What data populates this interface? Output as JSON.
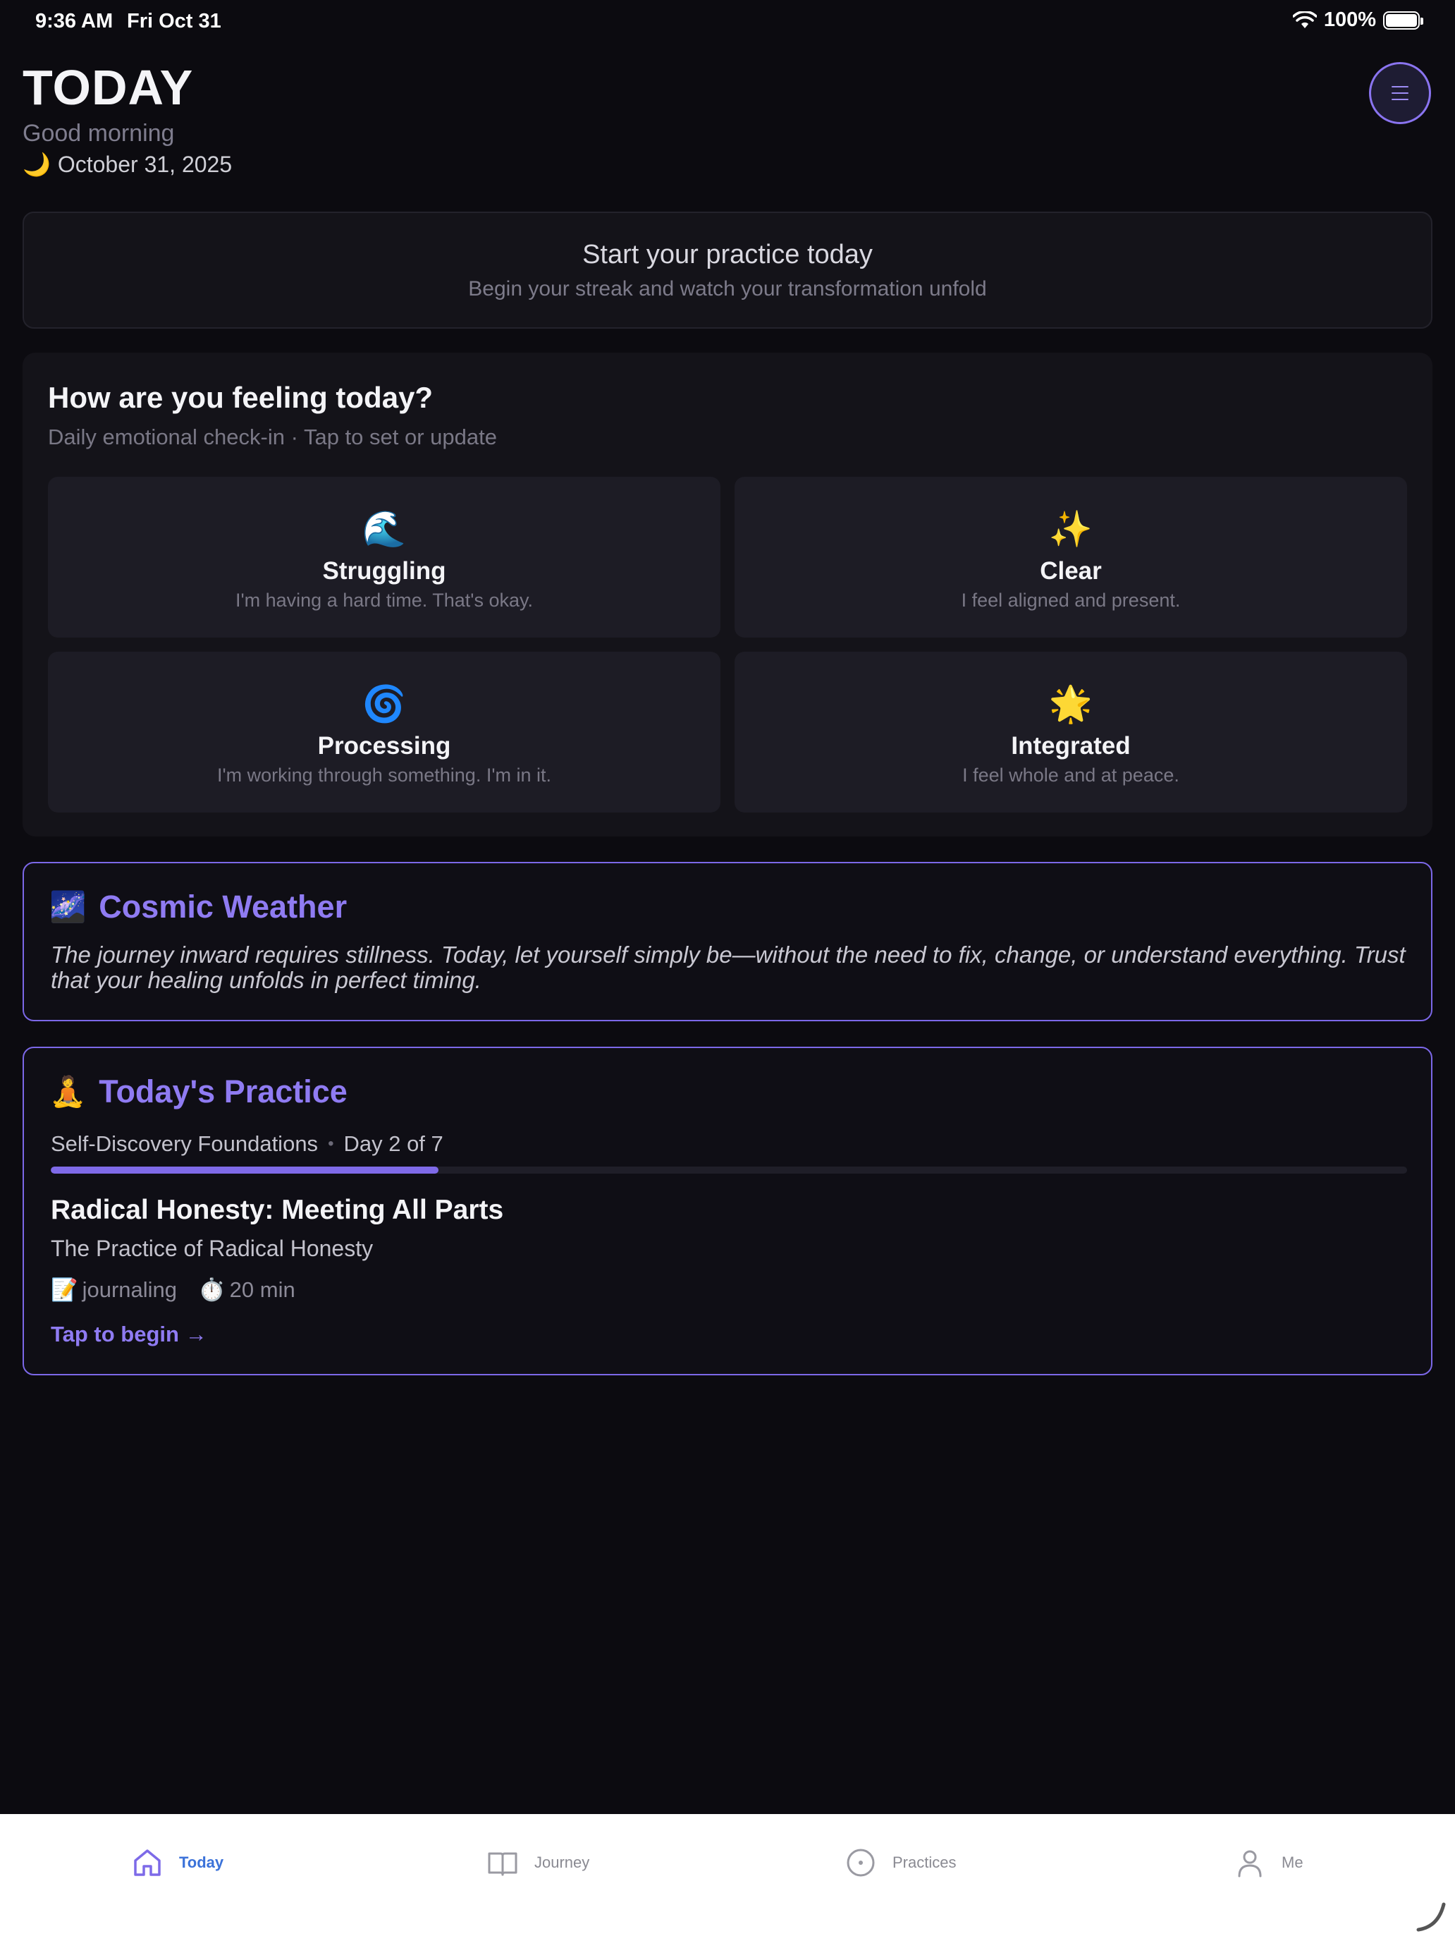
{
  "status_bar": {
    "time": "9:36 AM",
    "date": "Fri Oct 31",
    "battery": "100%",
    "battery_level_percent": 100
  },
  "header": {
    "title": "TODAY",
    "greeting": "Good morning",
    "date_icon": "🌙",
    "date": "October 31, 2025",
    "menu_icon": "menu-icon"
  },
  "streak": {
    "title": "Start your practice today",
    "subtitle": "Begin your streak and watch your transformation unfold"
  },
  "feeling": {
    "title": "How are you feeling today?",
    "subtitle": "Daily emotional check-in · Tap to set or update",
    "moods": [
      {
        "emoji": "🌊",
        "name": "Struggling",
        "desc": "I'm having a hard time. That's okay."
      },
      {
        "emoji": "✨",
        "name": "Clear",
        "desc": "I feel aligned and present."
      },
      {
        "emoji": "🌀",
        "name": "Processing",
        "desc": "I'm working through something. I'm in it."
      },
      {
        "emoji": "🌟",
        "name": "Integrated",
        "desc": "I feel whole and at peace."
      }
    ]
  },
  "cosmic": {
    "icon": "🌌",
    "title": "Cosmic Weather",
    "text": "The journey inward requires stillness. Today, let yourself simply be—without the need to fix, change, or understand everything. Trust that your healing unfolds in perfect timing."
  },
  "practice": {
    "icon": "🧘",
    "title": "Today's Practice",
    "program": "Self-Discovery Foundations",
    "separator": "•",
    "day": "Day 2 of 7",
    "progress_fraction": 0.2857,
    "lesson_title": "Radical Honesty: Meeting All Parts",
    "lesson_subtitle": "The Practice of Radical Honesty",
    "tag_type_icon": "📝",
    "tag_type": "journaling",
    "tag_time_icon": "⏱️",
    "tag_time": "20 min",
    "cta": "Tap to begin →"
  },
  "tabs": [
    {
      "label": "Today",
      "icon": "home-icon",
      "active": true
    },
    {
      "label": "Journey",
      "icon": "book-icon",
      "active": false
    },
    {
      "label": "Practices",
      "icon": "compass-icon",
      "active": false
    },
    {
      "label": "Me",
      "icon": "person-icon",
      "active": false
    }
  ],
  "colors": {
    "accent": "#8f7bf2",
    "background": "#0c0b10",
    "tab_active": "#3b72d9"
  }
}
